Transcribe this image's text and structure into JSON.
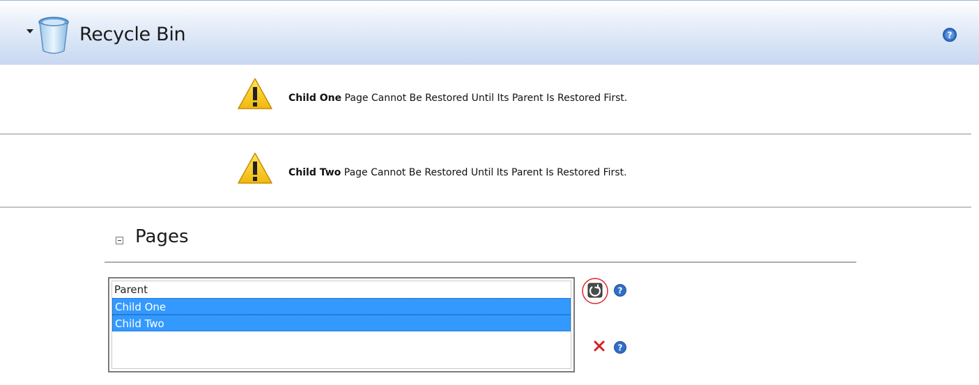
{
  "header": {
    "title": "Recycle Bin"
  },
  "messages": [
    {
      "bold": "Child One",
      "text": " Page Cannot Be Restored Until Its Parent Is Restored First."
    },
    {
      "bold": "Child Two",
      "text": " Page Cannot Be Restored Until Its Parent Is Restored First."
    }
  ],
  "pages": {
    "heading": "Pages",
    "items": [
      {
        "label": "Parent",
        "selected": false
      },
      {
        "label": "Child One",
        "selected": true
      },
      {
        "label": "Child Two",
        "selected": true
      }
    ]
  },
  "icons": {
    "collapse": "triangle-down-icon",
    "bin": "recycle-bin-icon",
    "help": "help-icon",
    "warning": "warning-icon",
    "section_toggle": "minus-box-icon",
    "restore": "restore-icon",
    "delete": "delete-x-icon"
  },
  "colors": {
    "header_gradient_bottom": "#c8d8f1",
    "selection": "#3399ff",
    "warning": "#f5c51a",
    "delete": "#d81e1e",
    "help": "#2f6fc7",
    "restore_highlight": "#e0262a"
  }
}
